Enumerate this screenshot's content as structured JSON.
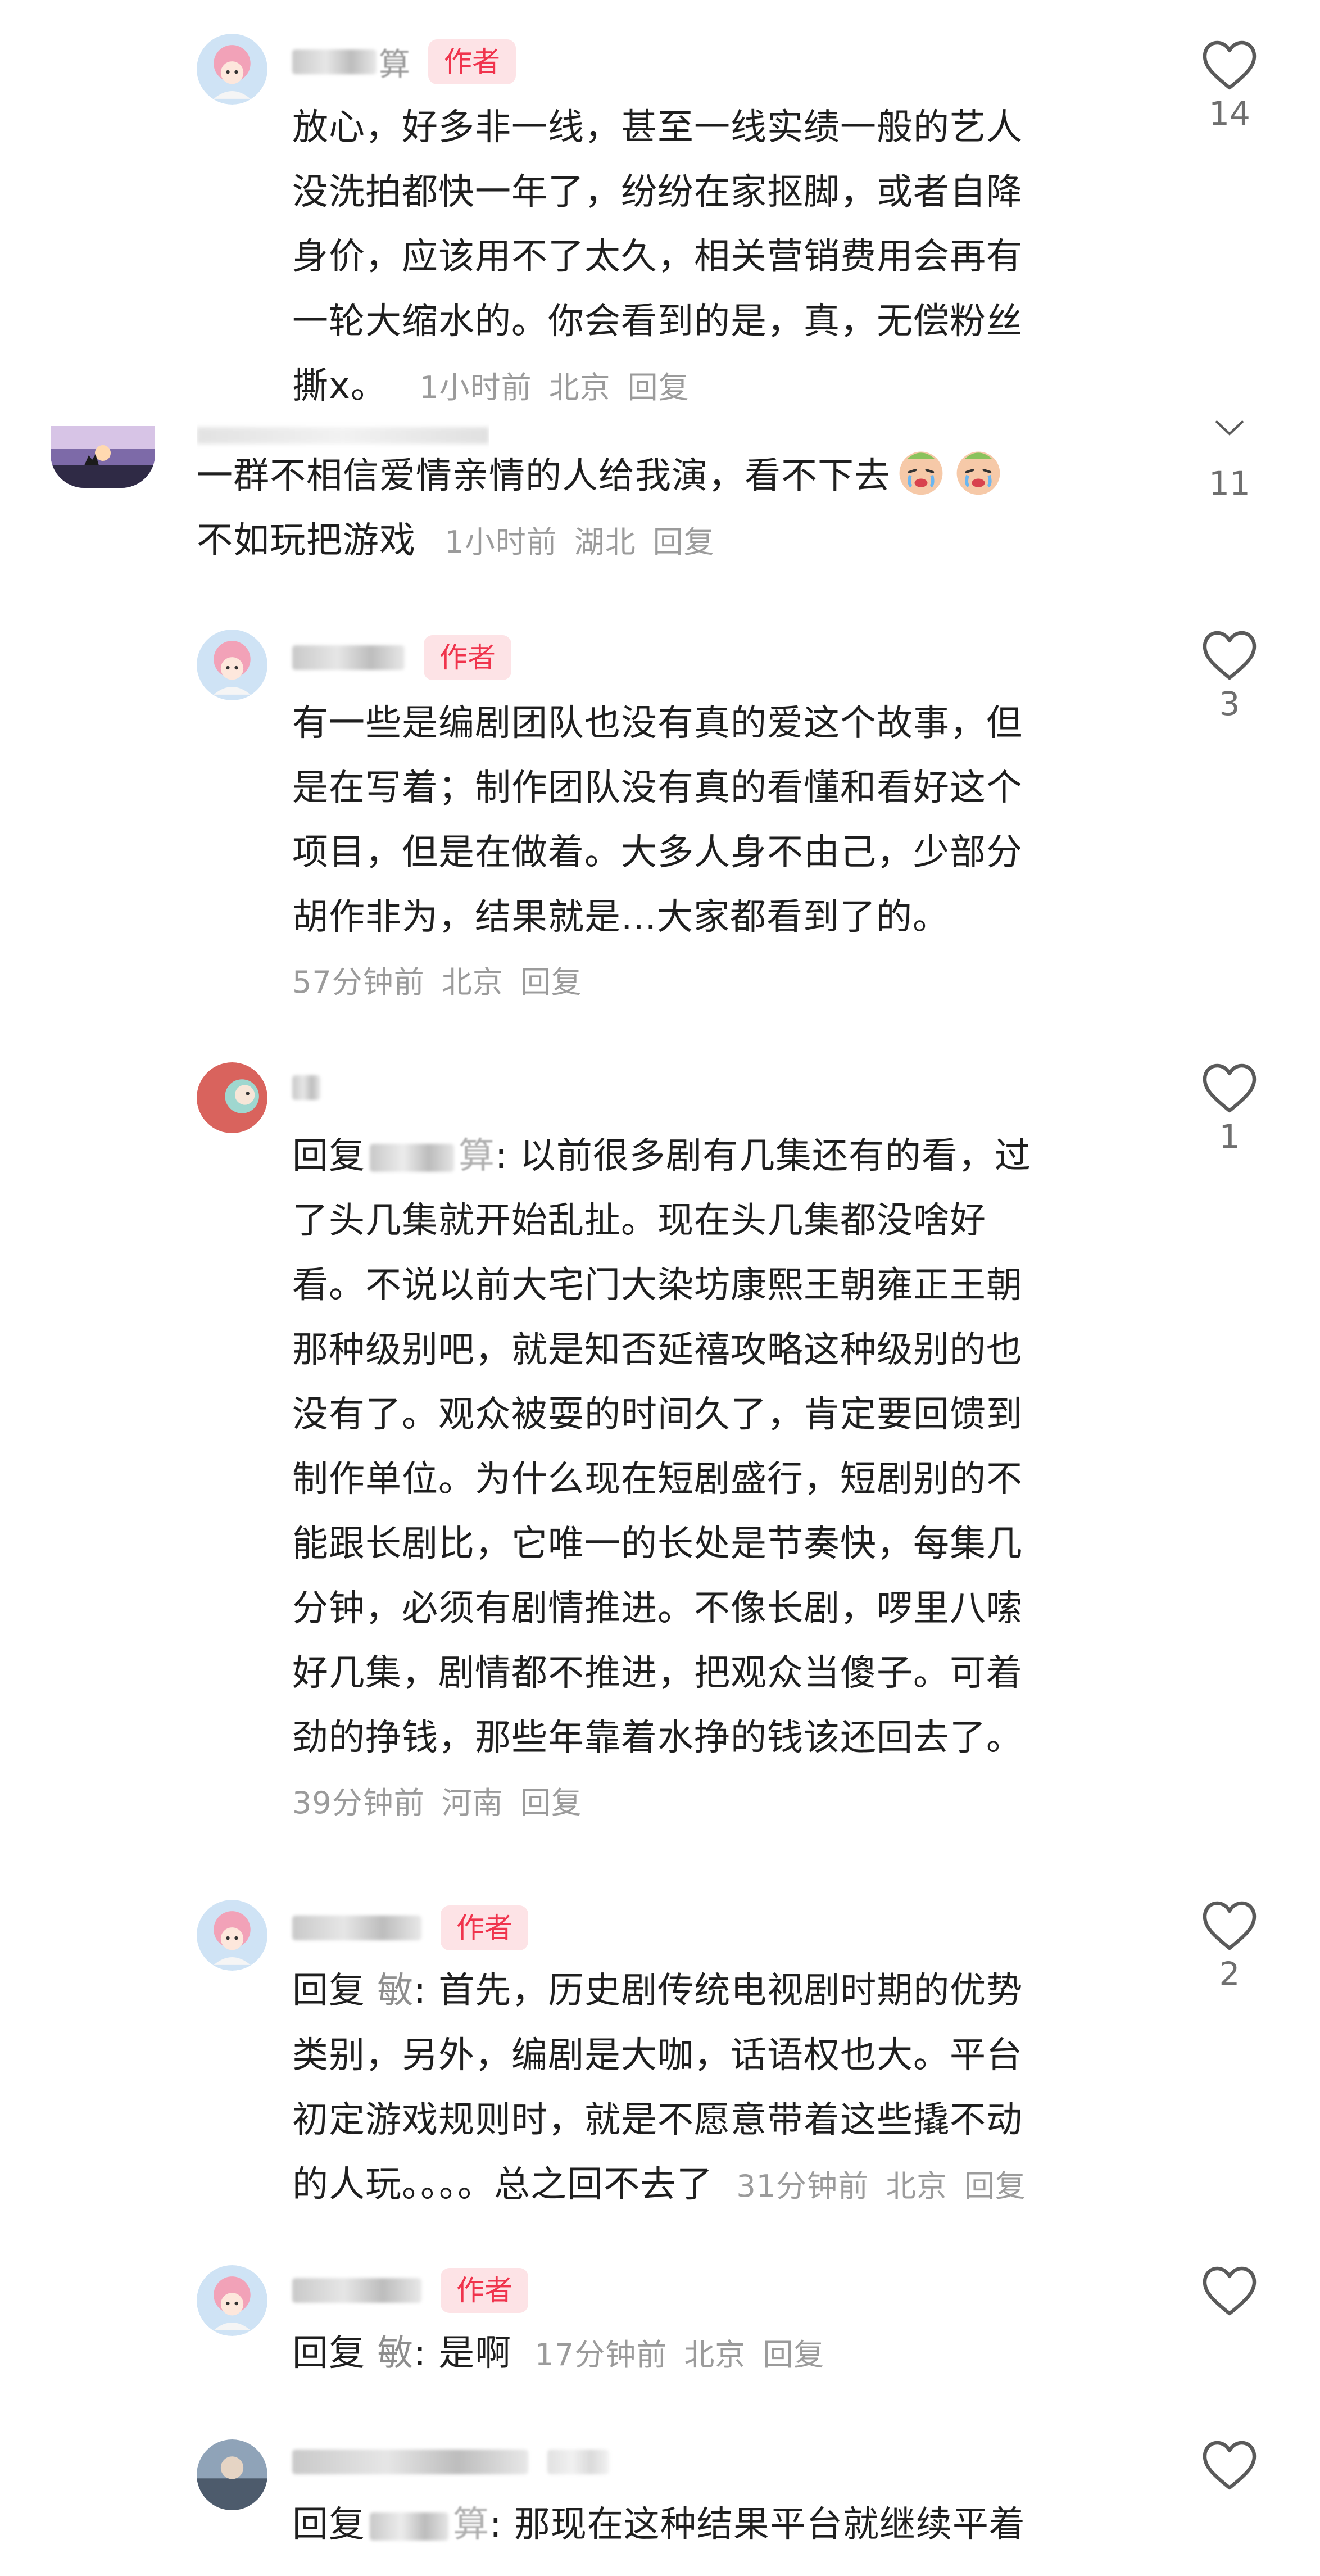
{
  "comments": [
    {
      "author_badge": "作者",
      "name_suffix": "算",
      "lines": [
        "放心，好多非一线，甚至一线实绩一般的艺人",
        "没洗拍都快一年了，纷纷在家抠脚，或者自降",
        "身价，应该用不了太久，相关营销费用会再有",
        "一轮大缩水的。你会看到的是，真，无偿粉丝"
      ],
      "last_line": "撕x。",
      "time": "1小时前",
      "location": "北京",
      "reply": "回复",
      "likes": "14"
    },
    {
      "line1": "一群不相信爱情亲情的人给我演，看不下去",
      "line2": "不如玩把游戏",
      "time": "1小时前",
      "location": "湖北",
      "reply": "回复",
      "likes": "11"
    },
    {
      "author_badge": "作者",
      "lines": [
        "有一些是编剧团队也没有真的爱这个故事，但",
        "是在写着；制作团队没有真的看懂和看好这个",
        "项目，但是在做着。大多人身不由己，少部分",
        "胡作非为，结果就是...大家都看到了的。"
      ],
      "time": "57分钟前",
      "location": "北京",
      "reply": "回复",
      "likes": "3"
    },
    {
      "reply_prefix": "回复",
      "reply_target_suffix": "算",
      "first_line_rest": ": 以前很多剧有几集还有的看，过",
      "lines": [
        "了头几集就开始乱扯。现在头几集都没啥好",
        "看。不说以前大宅门大染坊康熙王朝雍正王朝",
        "那种级别吧，就是知否延禧攻略这种级别的也",
        "没有了。观众被耍的时间久了，肯定要回馈到",
        "制作单位。为什么现在短剧盛行，短剧别的不",
        "能跟长剧比，它唯一的长处是节奏快，每集几",
        "分钟，必须有剧情推进。不像长剧，啰里八嗦",
        "好几集，剧情都不推进，把观众当傻子。可着",
        "劲的挣钱，那些年靠着水挣的钱该还回去了。"
      ],
      "time": "39分钟前",
      "location": "河南",
      "reply": "回复",
      "likes": "1"
    },
    {
      "author_badge": "作者",
      "reply_prefix": "回复",
      "reply_target": "敏",
      "first_line_rest": ": 首先，历史剧传统电视剧时期的优势",
      "lines": [
        "类别，另外，编剧是大咖，话语权也大。平台",
        "初定游戏规则时，就是不愿意带着这些撬不动"
      ],
      "last_text": "的人玩。。。。总之回不去了",
      "time": "31分钟前",
      "location": "北京",
      "reply": "回复",
      "likes": "2"
    },
    {
      "author_badge": "作者",
      "reply_prefix": "回复",
      "reply_target": "敏",
      "text": ": 是啊",
      "time": "17分钟前",
      "location": "北京",
      "reply": "回复",
      "likes": ""
    },
    {
      "reply_prefix": "回复",
      "reply_target_suffix": "算",
      "text": ": 那现在这种结果平台就继续平着",
      "likes": ""
    }
  ]
}
